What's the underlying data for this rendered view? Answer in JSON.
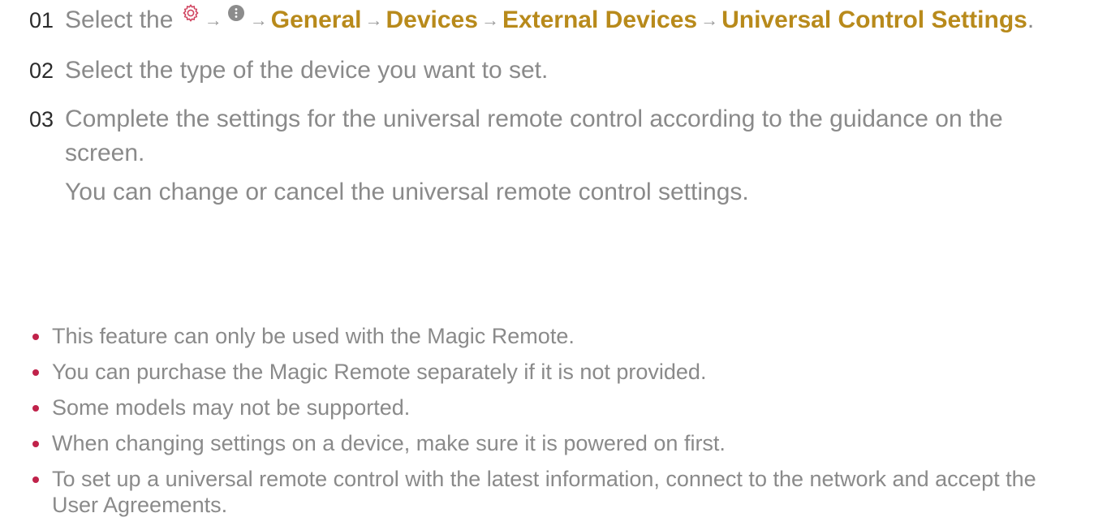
{
  "steps": [
    {
      "number": "01",
      "prefix": "Select the",
      "path": [
        "General",
        "Devices",
        "External Devices",
        "Universal Control Settings"
      ],
      "suffix": ".",
      "arrow": "→"
    },
    {
      "number": "02",
      "text": "Select the type of the device you want to set."
    },
    {
      "number": "03",
      "text": "Complete the settings for the universal remote control according to the guidance on the screen.",
      "note": "You can change or cancel the universal remote control settings."
    }
  ],
  "bullets": [
    "This feature can only be used with the Magic Remote.",
    "You can purchase the Magic Remote separately if it is not provided.",
    "Some models may not be supported.",
    "When changing settings on a device, make sure it is powered on first.",
    "To set up a universal remote control with the latest information, connect to the network and accept the User Agreements."
  ],
  "icons": {
    "settings": "gear-icon",
    "more": "more-options-icon"
  },
  "colors": {
    "path_link": "#b88a1b",
    "bullet": "#c0224a",
    "settings_icon": "#d0435f",
    "body_text": "#8a8a8a"
  }
}
